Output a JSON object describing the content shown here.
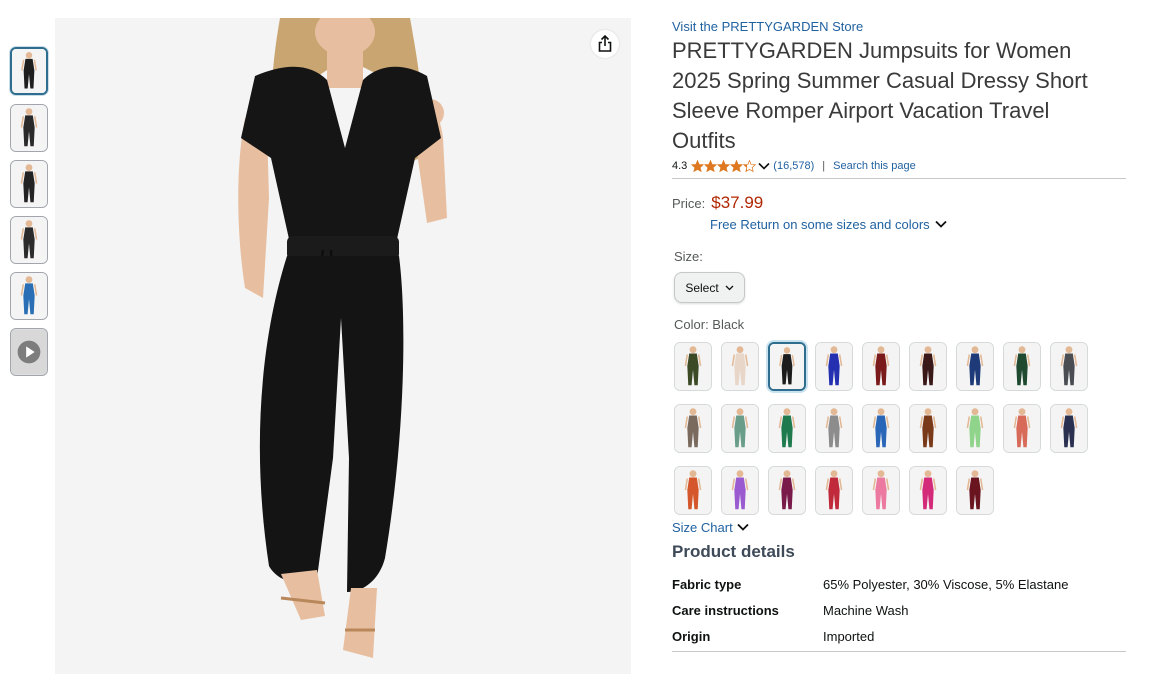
{
  "product": {
    "store_link": "Visit the PRETTYGARDEN Store",
    "title": "PRETTYGARDEN Jumpsuits for Women 2025 Spring Summer Casual Dressy Short Sleeve Romper Airport Vacation Travel Outfits",
    "rating": "4.3",
    "rating_stars": 4.3,
    "rating_count": "(16,578)",
    "separator": "|",
    "search_page": "Search this page",
    "price_label": "Price:",
    "price": "$37.99",
    "free_return": "Free Return on some sizes and colors",
    "size_label": "Size:",
    "size_select": "Select",
    "color_label": "Color: Black",
    "size_chart": "Size Chart",
    "details_heading": "Product details",
    "details": [
      {
        "key": "Fabric type",
        "value": "65% Polyester, 30% Viscose, 5% Elastane"
      },
      {
        "key": "Care instructions",
        "value": "Machine Wash"
      },
      {
        "key": "Origin",
        "value": "Imported"
      }
    ]
  },
  "colors": {
    "link": "#2162a1",
    "price": "#b12704",
    "selected_border": "#2e6d8e",
    "star": "#de7921"
  },
  "thumbnails": [
    {
      "name": "front-black",
      "color": "#1e1e1e",
      "active": true
    },
    {
      "name": "street-black",
      "color": "#2a2a2a",
      "active": false
    },
    {
      "name": "lifestyle-black",
      "color": "#232323",
      "active": false
    },
    {
      "name": "travel-black",
      "color": "#2b2b2b",
      "active": false
    },
    {
      "name": "luggage-blue",
      "color": "#2a6fb5",
      "active": false
    },
    {
      "name": "video",
      "color": "#9a9a9a",
      "active": false
    }
  ],
  "swatches": [
    "#3d4a26",
    "#e8d6c8",
    "#1c1c1c",
    "#2430b0",
    "#7a1a1a",
    "#3a1818",
    "#1f3a78",
    "#1f4a30",
    "#4a4e52",
    "#7a6a5e",
    "#6b9e8a",
    "#1f7a4e",
    "#8c8c8c",
    "#2a66b8",
    "#7a3a1a",
    "#8fd48a",
    "#d86a5a",
    "#2a3050",
    "#d4562a",
    "#9a5ad0",
    "#7a1a4a",
    "#c02a3a",
    "#ec7aa0",
    "#d42a7a",
    "#6a1420"
  ],
  "icons": {
    "share": "share-icon",
    "chevron": "chevron-down-icon",
    "star": "star-icon",
    "play": "play-icon"
  }
}
